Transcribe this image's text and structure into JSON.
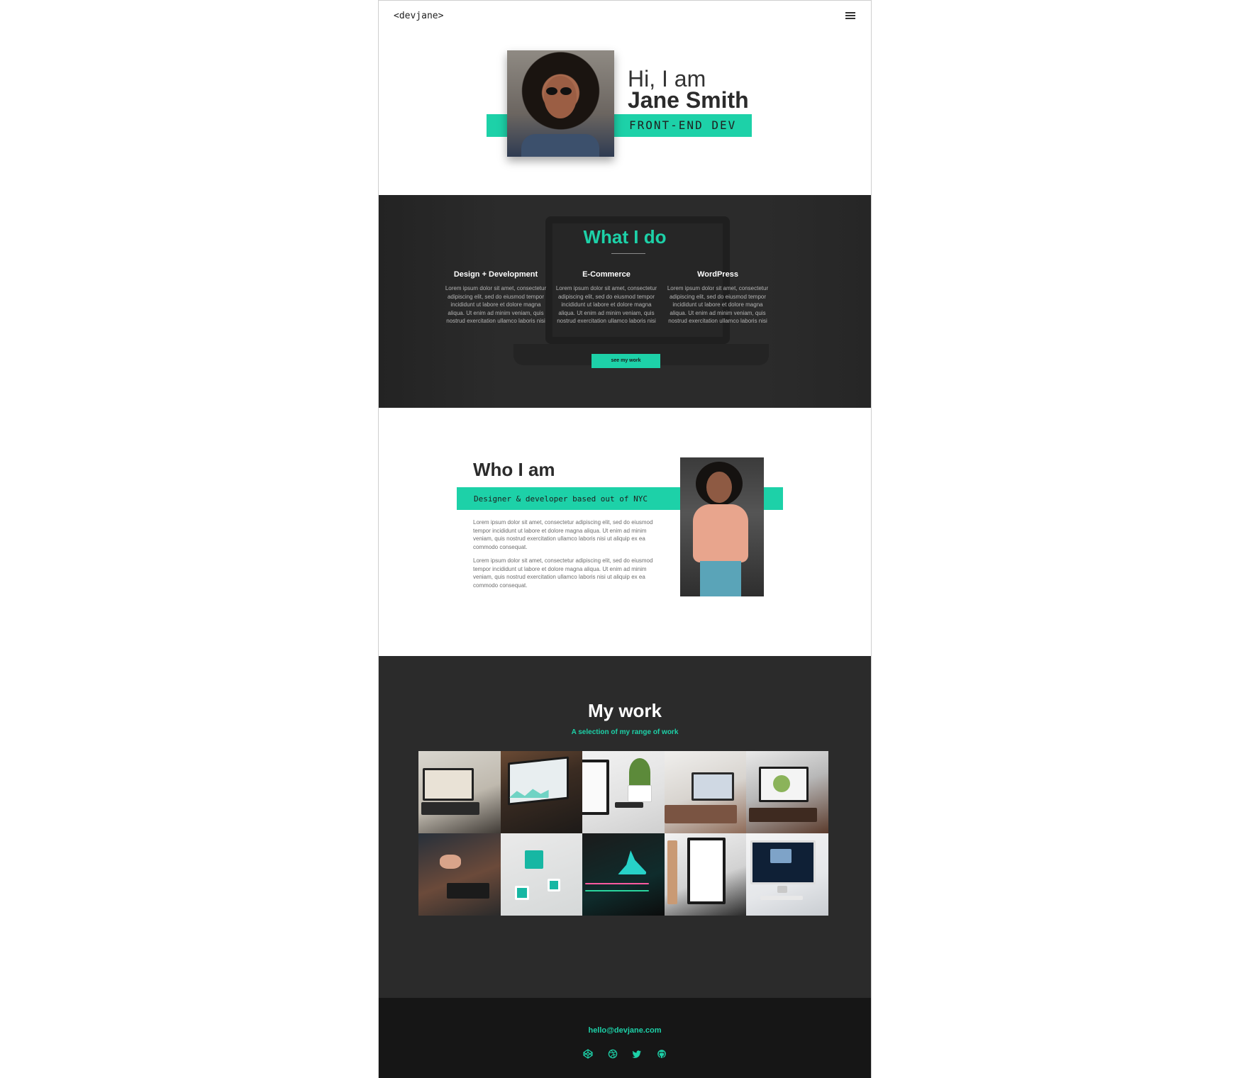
{
  "header": {
    "logo": "<devjane>",
    "menu_icon": "hamburger-menu-icon"
  },
  "hero": {
    "greeting": "Hi, I am",
    "name": "Jane Smith",
    "role": "FRONT-END DEV"
  },
  "services": {
    "title": "What I do",
    "items": [
      {
        "title": "Design + Development",
        "body": "Lorem ipsum dolor sit amet, consectetur adipiscing elit, sed do eiusmod tempor incididunt ut labore et dolore magna aliqua. Ut enim ad minim veniam, quis nostrud exercitation ullamco laboris nisi"
      },
      {
        "title": "E-Commerce",
        "body": "Lorem ipsum dolor sit amet, consectetur adipiscing elit, sed do eiusmod tempor incididunt ut labore et dolore magna aliqua. Ut enim ad minim veniam, quis nostrud exercitation ullamco laboris nisi"
      },
      {
        "title": "WordPress",
        "body": "Lorem ipsum dolor sit amet, consectetur adipiscing elit, sed do eiusmod tempor incididunt ut labore et dolore magna aliqua. Ut enim ad minim veniam, quis nostrud exercitation ullamco laboris nisi"
      }
    ],
    "button_label": "see my work"
  },
  "about": {
    "title": "Who I am",
    "subtitle": "Designer & developer based out of NYC",
    "paragraphs": [
      "Lorem ipsum dolor sit amet, consectetur adipiscing elit, sed do eiusmod tempor incididunt ut labore et dolore magna aliqua. Ut enim ad minim veniam, quis nostrud exercitation ullamco laboris nisi ut aliquip ex ea commodo consequat.",
      "Lorem ipsum dolor sit amet, consectetur adipiscing elit, sed do eiusmod tempor incididunt ut labore et dolore magna aliqua. Ut enim ad minim veniam, quis nostrud exercitation ullamco laboris nisi ut aliquip ex ea commodo consequat."
    ]
  },
  "work": {
    "title": "My work",
    "subtitle": "A selection of my range of work",
    "tiles": 10
  },
  "footer": {
    "email": "hello@devjane.com",
    "social_icons": [
      "codepen-icon",
      "dribbble-icon",
      "twitter-icon",
      "github-icon"
    ]
  },
  "colors": {
    "accent": "#1dd1a8",
    "dark": "#2b2b2b",
    "footer": "#161616"
  }
}
